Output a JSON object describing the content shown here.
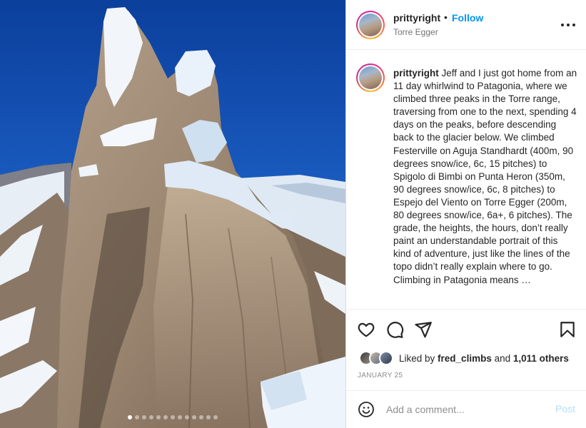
{
  "post": {
    "username": "prittyright",
    "separator": "•",
    "follow_label": "Follow",
    "location": "Torre Egger",
    "more_icon": "more-horizontal-icon"
  },
  "caption": {
    "username": "prittyright",
    "text": "Jeff and I just got home from an 11 day whirlwind to Patagonia, where we climbed three peaks in the Torre range, traversing from one to the next, spending 4 days on the peaks, before descending back to the glacier below. We climbed Festerville on Aguja Standhardt (400m, 90 degrees snow/ice, 6c, 15 pitches) to Spigolo di Bimbi on Punta Heron (350m, 90 degrees snow/ice, 6c, 8 pitches) to Espejo del Viento on Torre Egger (200m, 80 degrees snow/ice, 6a+, 6 pitches). The grade, the heights, the hours, don’t really paint an understandable portrait of this kind of adventure, just like the lines of the topo didn’t really explain where to go. Climbing in Patagonia means …"
  },
  "actions": {
    "like_icon": "heart-icon",
    "comment_icon": "comment-icon",
    "share_icon": "paper-plane-icon",
    "save_icon": "bookmark-icon"
  },
  "likes": {
    "prefix": "Liked by ",
    "user": "fred_climbs",
    "middle": " and ",
    "others": "1,011 others"
  },
  "date": "JANUARY 25",
  "comment": {
    "placeholder": "Add a comment...",
    "post_label": "Post",
    "emoji_icon": "smiley-icon"
  },
  "carousel": {
    "total": 13,
    "active": 1
  },
  "colors": {
    "link": "#0095f6",
    "post_disabled": "#b2dffc",
    "secondary_text": "#737373"
  }
}
